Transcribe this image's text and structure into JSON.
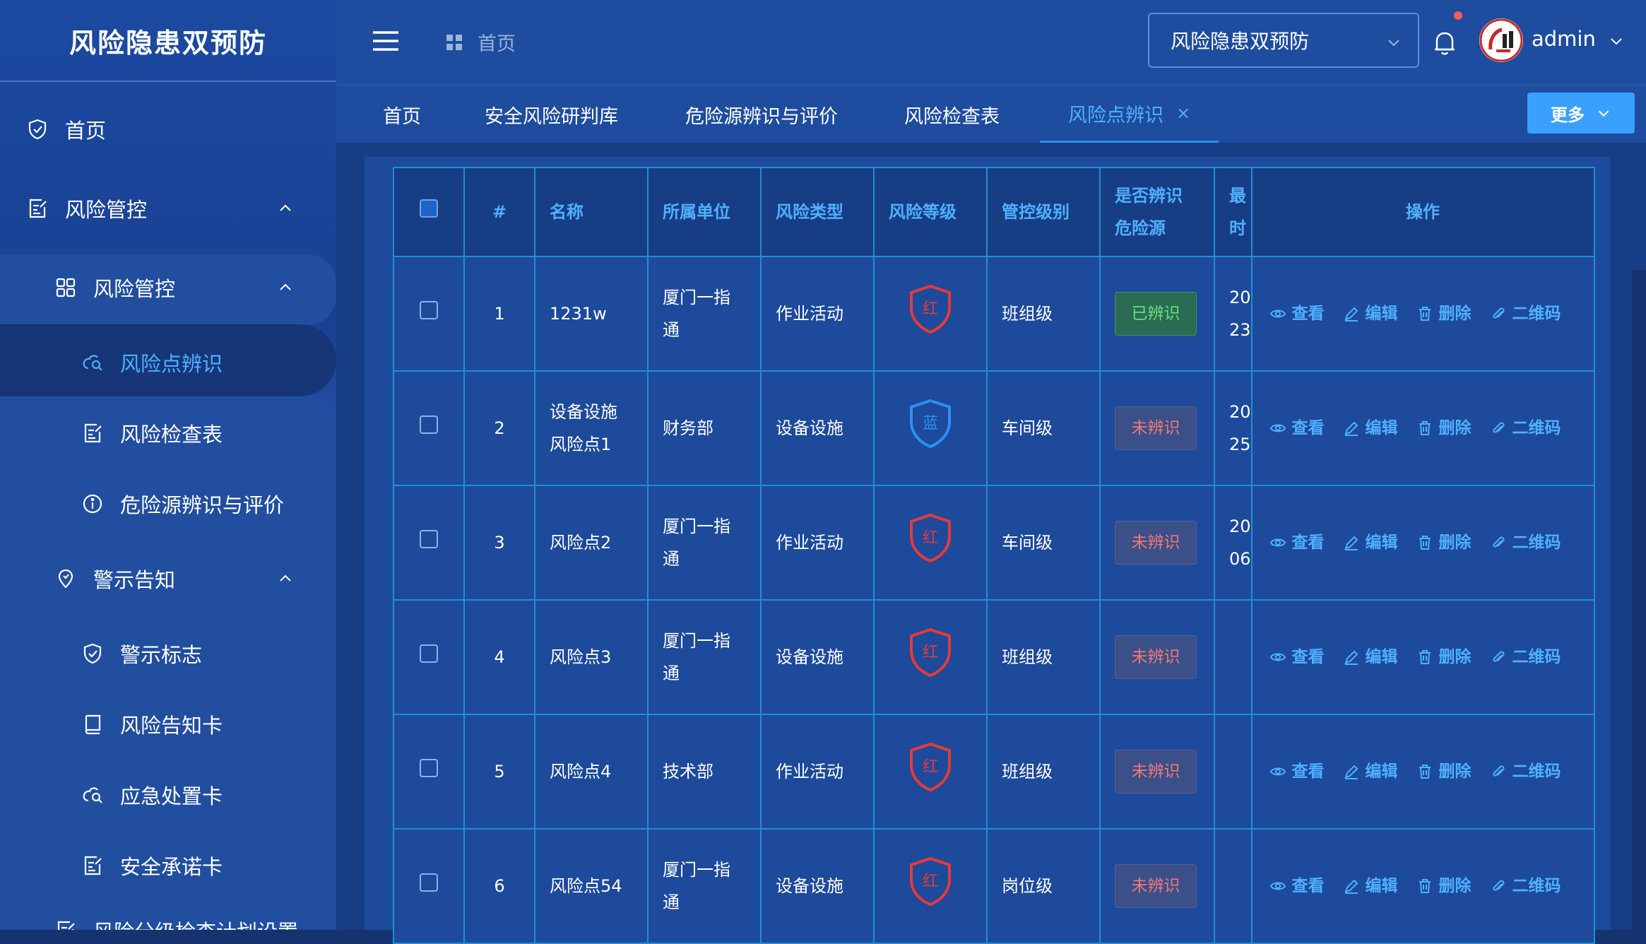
{
  "app": {
    "title": "风险隐患双预防"
  },
  "sidebar": {
    "items": [
      {
        "label": "首页",
        "icon": "shield-check-icon"
      },
      {
        "label": "风险管控",
        "icon": "edit-doc-icon"
      },
      {
        "label": "风险管控",
        "icon": "grid-icon"
      },
      {
        "label": "风险点辨识",
        "icon": "cloud-search-icon",
        "active": true
      },
      {
        "label": "风险检查表",
        "icon": "edit-doc-icon"
      },
      {
        "label": "危险源辨识与评价",
        "icon": "info-icon"
      },
      {
        "label": "警示告知",
        "icon": "alert-pin-icon"
      },
      {
        "label": "警示标志",
        "icon": "shield-check-icon"
      },
      {
        "label": "风险告知卡",
        "icon": "notebook-icon"
      },
      {
        "label": "应急处置卡",
        "icon": "cloud-search-icon"
      },
      {
        "label": "安全承诺卡",
        "icon": "edit-doc-icon"
      },
      {
        "label": "风险分级检查计划设置",
        "icon": "edit-doc-icon"
      }
    ]
  },
  "header": {
    "breadcrumb": "首页",
    "system_select": "风险隐患双预防",
    "username": "admin"
  },
  "tabs": {
    "items": [
      {
        "label": "首页"
      },
      {
        "label": "安全风险研判库"
      },
      {
        "label": "危险源辨识与评价"
      },
      {
        "label": "风险检查表"
      },
      {
        "label": "风险点辨识",
        "active": true,
        "close": "×"
      }
    ],
    "more_label": "更多"
  },
  "table": {
    "headers": {
      "index": "#",
      "name": "名称",
      "unit": "所属单位",
      "risk_type": "风险类型",
      "risk_level": "风险等级",
      "control_level": "管控级别",
      "identified_1": "是否辨识",
      "identified_2": "危险源",
      "last_1": "最",
      "last_2": "时",
      "actions": "操作"
    },
    "actions": {
      "view": "查看",
      "edit": "编辑",
      "delete": "删除",
      "qrcode": "二维码"
    },
    "rows": [
      {
        "index": "1",
        "name": "1231w",
        "unit": "厦门一指通",
        "risk_type": "作业活动",
        "level": "红",
        "level_color": "#e53a3a",
        "control": "班组级",
        "identified": "已辨识",
        "identified_state": "yes",
        "time_1": "20",
        "time_2": "23"
      },
      {
        "index": "2",
        "name": "设备设施风险点1",
        "unit": "财务部",
        "risk_type": "设备设施",
        "level": "蓝",
        "level_color": "#2e8ff0",
        "control": "车间级",
        "identified": "未辨识",
        "identified_state": "no",
        "time_1": "20",
        "time_2": "25"
      },
      {
        "index": "3",
        "name": "风险点2",
        "unit": "厦门一指通",
        "risk_type": "作业活动",
        "level": "红",
        "level_color": "#e53a3a",
        "control": "车间级",
        "identified": "未辨识",
        "identified_state": "no",
        "time_1": "20",
        "time_2": "06"
      },
      {
        "index": "4",
        "name": "风险点3",
        "unit": "厦门一指通",
        "risk_type": "设备设施",
        "level": "红",
        "level_color": "#e53a3a",
        "control": "班组级",
        "identified": "未辨识",
        "identified_state": "no",
        "time_1": "",
        "time_2": ""
      },
      {
        "index": "5",
        "name": "风险点4",
        "unit": "技术部",
        "risk_type": "作业活动",
        "level": "红",
        "level_color": "#e53a3a",
        "control": "班组级",
        "identified": "未辨识",
        "identified_state": "no",
        "time_1": "",
        "time_2": ""
      },
      {
        "index": "6",
        "name": "风险点54",
        "unit": "厦门一指通",
        "risk_type": "设备设施",
        "level": "红",
        "level_color": "#e53a3a",
        "control": "岗位级",
        "identified": "未辨识",
        "identified_state": "no",
        "time_1": "",
        "time_2": ""
      }
    ]
  },
  "colors": {
    "accent": "#4fb0ff",
    "table_border": "#1e8fd6",
    "sidebar_bg": "#1c4aa2",
    "header_bg": "#1e4c9e"
  }
}
